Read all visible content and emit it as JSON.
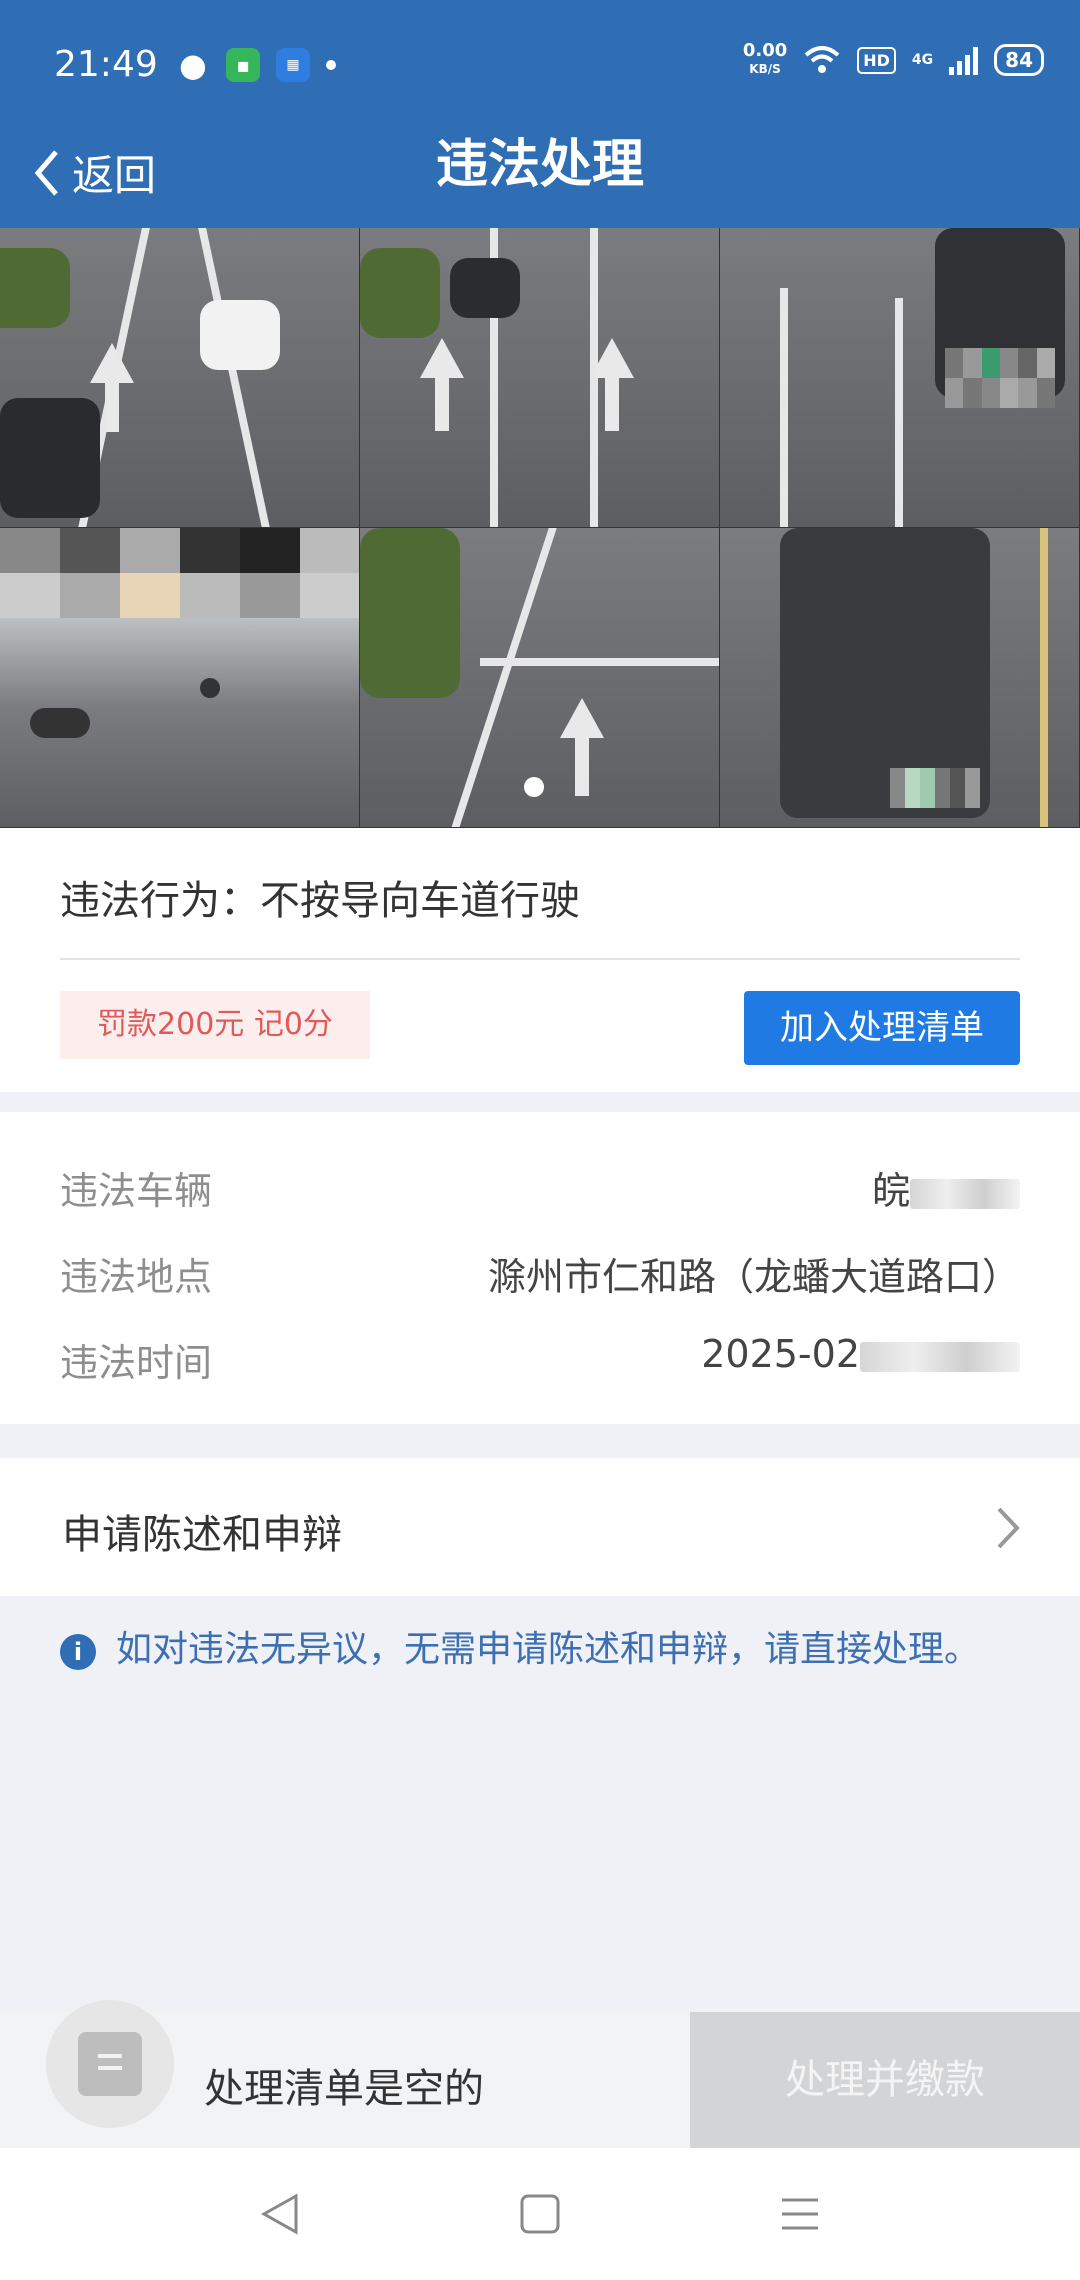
{
  "status_bar": {
    "time": "21:49",
    "net_speed_value": "0.00",
    "net_speed_unit": "KB/S",
    "hd": "HD",
    "network": "4G",
    "battery": "84"
  },
  "header": {
    "back_label": "返回",
    "title": "违法处理"
  },
  "violation": {
    "behavior_label": "违法行为：",
    "behavior_value": "不按导向车道行驶",
    "fine": "罚款200元 记0分",
    "add_button": "加入处理清单"
  },
  "details": {
    "vehicle_label": "违法车辆",
    "vehicle_value": "皖",
    "location_label": "违法地点",
    "location_value": "滁州市仁和路（龙蟠大道路口）",
    "time_label": "违法时间",
    "time_value": "2025-02"
  },
  "statement": {
    "label": "申请陈述和申辩"
  },
  "notice": {
    "text": "如对违法无异议，无需申请陈述和申辩，请直接处理。"
  },
  "bottom_bar": {
    "empty_text": "处理清单是空的",
    "pay_button": "处理并缴款"
  },
  "colors": {
    "brand": "#2f6db5",
    "accent_button": "#1f7be3",
    "fine_text": "#e05a5a"
  }
}
